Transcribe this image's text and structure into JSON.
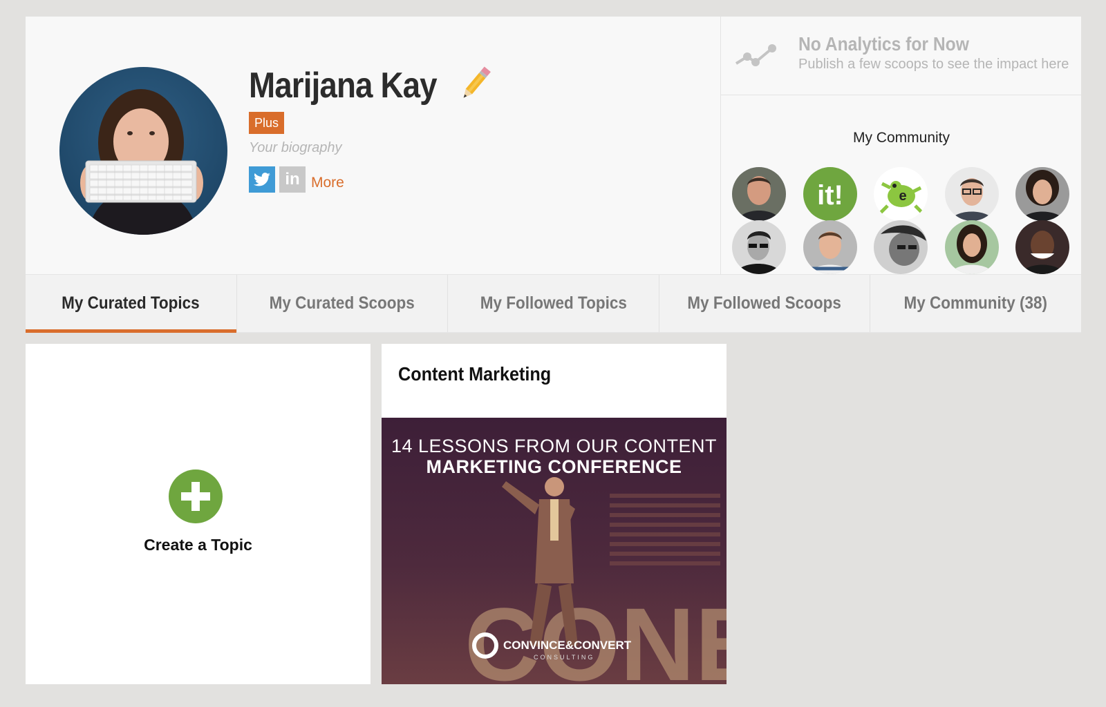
{
  "profile": {
    "name": "Marijana Kay",
    "badge": "Plus",
    "bio_placeholder": "Your biography",
    "social": {
      "twitter_icon": "twitter-icon",
      "linkedin_icon": "linkedin-icon",
      "linkedin_label": "in",
      "more_label": "More"
    }
  },
  "analytics": {
    "title": "No Analytics for Now",
    "subtitle": "Publish a few scoops to see the impact here"
  },
  "community": {
    "title": "My Community"
  },
  "tabs": [
    {
      "label": "My Curated Topics",
      "active": true
    },
    {
      "label": "My Curated Scoops",
      "active": false
    },
    {
      "label": "My Followed Topics",
      "active": false
    },
    {
      "label": "My Followed Scoops",
      "active": false
    },
    {
      "label": "My Community (38)",
      "active": false
    }
  ],
  "create_topic": {
    "label": "Create a Topic"
  },
  "topics": [
    {
      "title": "Content Marketing",
      "image_headline_1": "14 LESSONS FROM OUR CONTENT",
      "image_headline_2": "MARKETING CONFERENCE",
      "image_brand": "CONVINCE&CONVERT",
      "image_brand_sub": "CONSULTING",
      "image_stage_text": "CONE"
    }
  ],
  "colors": {
    "accent": "#d96d2b",
    "twitter": "#3f9bd6",
    "create_green": "#6fa63f"
  }
}
